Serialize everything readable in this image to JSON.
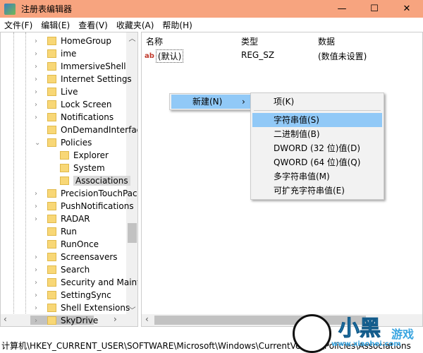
{
  "window": {
    "title": "注册表编辑器",
    "minimize": "—",
    "maximize": "☐",
    "close": "✕"
  },
  "menu": [
    "文件(F)",
    "编辑(E)",
    "查看(V)",
    "收藏夹(A)",
    "帮助(H)"
  ],
  "tree": [
    {
      "label": "HomeGroup",
      "level": 1,
      "exp": true
    },
    {
      "label": "ime",
      "level": 1,
      "exp": true
    },
    {
      "label": "ImmersiveShell",
      "level": 1,
      "exp": true
    },
    {
      "label": "Internet Settings",
      "level": 1,
      "exp": true
    },
    {
      "label": "Live",
      "level": 1,
      "exp": true
    },
    {
      "label": "Lock Screen",
      "level": 1,
      "exp": true
    },
    {
      "label": "Notifications",
      "level": 1,
      "exp": true
    },
    {
      "label": "OnDemandInterfac",
      "level": 1,
      "exp": false
    },
    {
      "label": "Policies",
      "level": 1,
      "exp": "open"
    },
    {
      "label": "Explorer",
      "level": 2,
      "exp": false
    },
    {
      "label": "System",
      "level": 2,
      "exp": false
    },
    {
      "label": "Associations",
      "level": 2,
      "exp": false,
      "selected": true
    },
    {
      "label": "PrecisionTouchPac",
      "level": 1,
      "exp": true
    },
    {
      "label": "PushNotifications",
      "level": 1,
      "exp": true
    },
    {
      "label": "RADAR",
      "level": 1,
      "exp": true
    },
    {
      "label": "Run",
      "level": 1,
      "exp": false
    },
    {
      "label": "RunOnce",
      "level": 1,
      "exp": false
    },
    {
      "label": "Screensavers",
      "level": 1,
      "exp": true
    },
    {
      "label": "Search",
      "level": 1,
      "exp": true
    },
    {
      "label": "Security and Maint",
      "level": 1,
      "exp": true
    },
    {
      "label": "SettingSync",
      "level": 1,
      "exp": true
    },
    {
      "label": "Shell Extensions",
      "level": 1,
      "exp": true
    },
    {
      "label": "SkyDrive",
      "level": 1,
      "exp": true
    }
  ],
  "list": {
    "headers": [
      "名称",
      "类型",
      "数据"
    ],
    "rows": [
      {
        "name": "(默认)",
        "type": "REG_SZ",
        "data": "(数值未设置)",
        "icon": "ab"
      }
    ]
  },
  "context_menu": {
    "new": "新建(N)",
    "arrow": "›"
  },
  "submenu": [
    "项(K)",
    "字符串值(S)",
    "二进制值(B)",
    "DWORD (32 位)值(D)",
    "QWORD (64 位)值(Q)",
    "多字符串值(M)",
    "可扩充字符串值(E)"
  ],
  "status": "计算机\\HKEY_CURRENT_USER\\SOFTWARE\\Microsoft\\Windows\\CurrentVersion\\Policies\\Associations",
  "watermark": {
    "logo": "小黑游戏",
    "url": "www.xiaohei.com"
  }
}
